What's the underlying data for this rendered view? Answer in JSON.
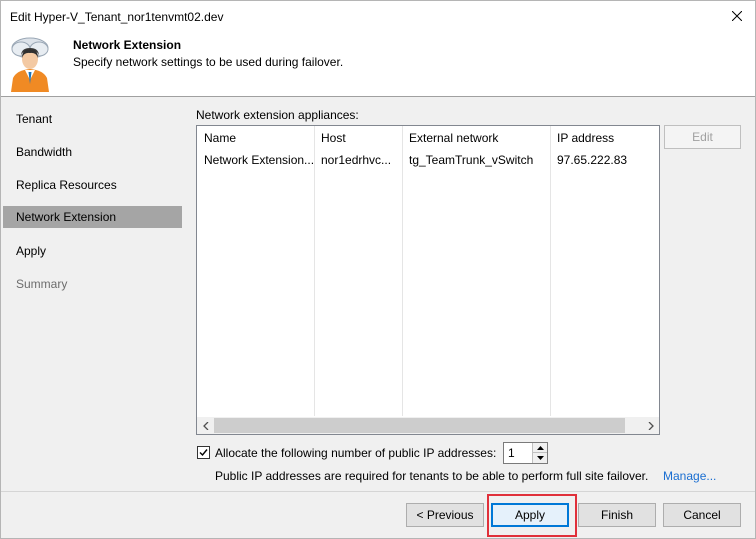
{
  "window": {
    "title": "Edit Hyper-V_Tenant_nor1tenvmt02.dev",
    "close_icon": "close-icon"
  },
  "header": {
    "title": "Network Extension",
    "subtitle": "Specify network settings to be used during failover.",
    "icon": "user-cloud-icon"
  },
  "sidebar": {
    "items": [
      {
        "label": "Tenant",
        "state": "normal"
      },
      {
        "label": "Bandwidth",
        "state": "normal"
      },
      {
        "label": "Replica Resources",
        "state": "normal"
      },
      {
        "label": "Network Extension",
        "state": "active"
      },
      {
        "label": "Apply",
        "state": "normal"
      },
      {
        "label": "Summary",
        "state": "disabled"
      }
    ]
  },
  "main": {
    "list_label": "Network extension appliances:",
    "columns": [
      "Name",
      "Host",
      "External network",
      "IP address"
    ],
    "rows": [
      [
        "Network Extension...",
        "nor1edrhvc...",
        "tg_TeamTrunk_vSwitch",
        "97.65.222.83"
      ]
    ],
    "edit_label": "Edit",
    "allocate_label": "Allocate the following number of public IP addresses:",
    "allocate_checked": true,
    "allocate_value": "1",
    "note": "Public IP addresses are required for tenants to be able to perform full site failover.",
    "manage_link": "Manage..."
  },
  "footer": {
    "previous_label": "< Previous",
    "apply_label": "Apply",
    "finish_label": "Finish",
    "cancel_label": "Cancel"
  },
  "colors": {
    "sidebar_bg": "#f0f0f0",
    "active_item_bg": "#a5a5a5",
    "link": "#1a6ed1",
    "focus_button_border": "#0078d7",
    "highlight_box": "#e0303a"
  }
}
